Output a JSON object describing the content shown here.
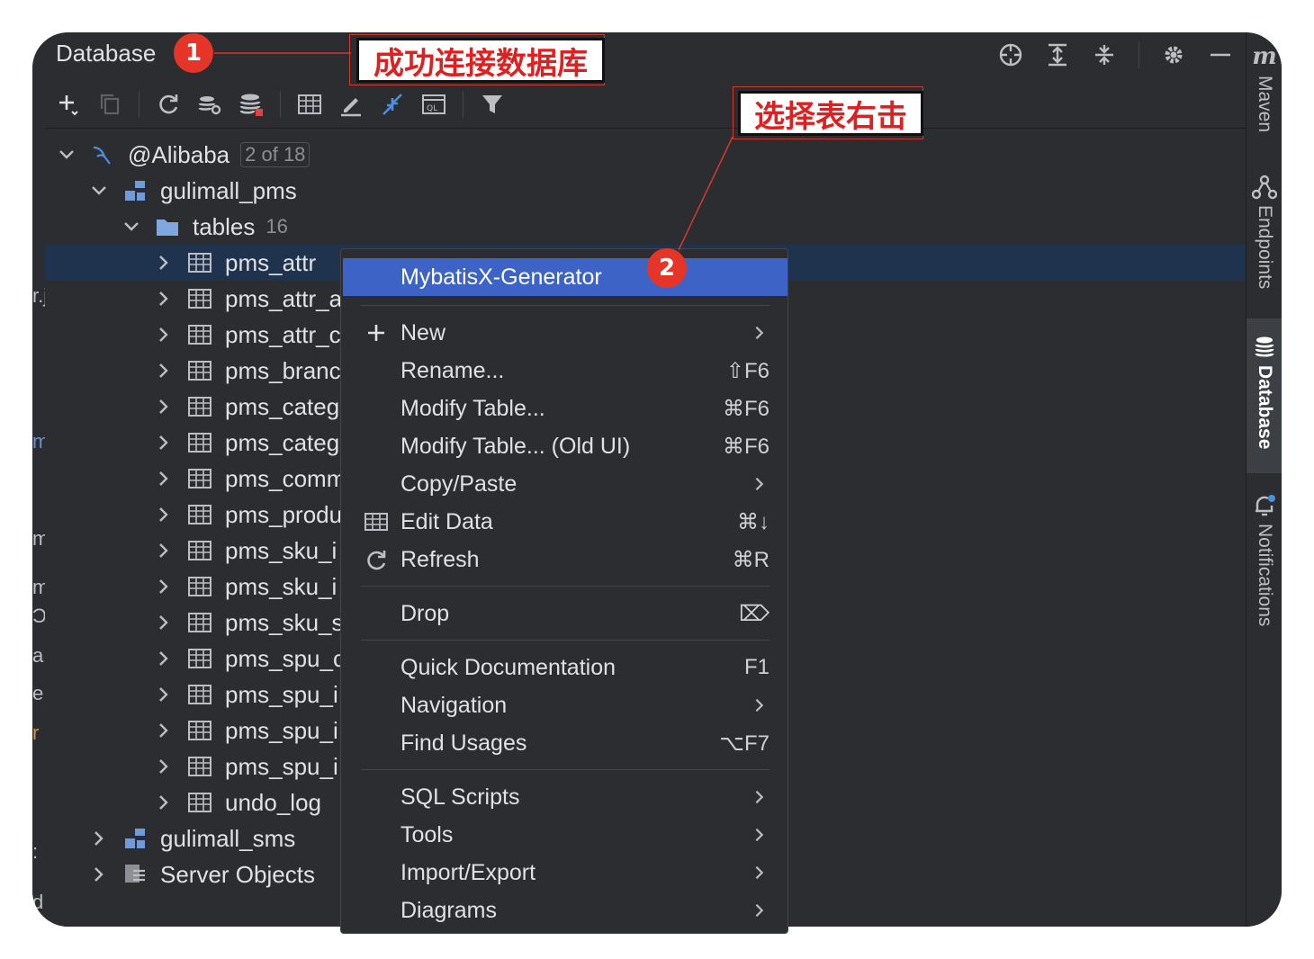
{
  "panel": {
    "title": "Database"
  },
  "tree": {
    "connection": {
      "label": "@Alibaba",
      "badge": "2 of 18"
    },
    "schema": "gulimall_pms",
    "tables_folder": {
      "label": "tables",
      "count": "16"
    },
    "tables": [
      "pms_attr",
      "pms_attr_a",
      "pms_attr_c",
      "pms_branc",
      "pms_categ",
      "pms_categ",
      "pms_comm",
      "pms_produ",
      "pms_sku_i",
      "pms_sku_i",
      "pms_sku_s",
      "pms_spu_c",
      "pms_spu_i",
      "pms_spu_i",
      "pms_spu_i",
      "undo_log"
    ],
    "other_schemas": [
      "gulimall_sms",
      "Server Objects"
    ]
  },
  "context_menu": {
    "highlighted": "MybatisX-Generator",
    "items": [
      {
        "label": "New",
        "shortcut": "",
        "submenu": true,
        "icon": "plus-icon"
      },
      {
        "label": "Rename...",
        "shortcut": "⇧F6"
      },
      {
        "label": "Modify Table...",
        "shortcut": "⌘F6"
      },
      {
        "label": "Modify Table... (Old UI)",
        "shortcut": "⌘F6"
      },
      {
        "label": "Copy/Paste",
        "shortcut": "",
        "submenu": true
      },
      {
        "label": "Edit Data",
        "shortcut": "⌘↓",
        "icon": "table-grid-icon"
      },
      {
        "label": "Refresh",
        "shortcut": "⌘R",
        "icon": "refresh-icon"
      },
      {
        "label": "Drop",
        "shortcut": "⌦"
      },
      {
        "label": "Quick Documentation",
        "shortcut": "F1"
      },
      {
        "label": "Navigation",
        "shortcut": "",
        "submenu": true
      },
      {
        "label": "Find Usages",
        "shortcut": "⌥F7"
      },
      {
        "label": "SQL Scripts",
        "shortcut": "",
        "submenu": true
      },
      {
        "label": "Tools",
        "shortcut": "",
        "submenu": true
      },
      {
        "label": "Import/Export",
        "shortcut": "",
        "submenu": true
      },
      {
        "label": "Diagrams",
        "shortcut": "",
        "submenu": true
      }
    ]
  },
  "side_tabs": {
    "maven": "Maven",
    "maven_logo": "m",
    "endpoints": "Endpoints",
    "database": "Database",
    "notifications": "Notifications"
  },
  "annotations": {
    "callout1": "成功连接数据库",
    "callout2": "选择表右击",
    "badge1": "1",
    "badge2": "2"
  },
  "left_edge_glyphs": [
    "r.j",
    "m",
    "m",
    "m",
    "Ɔ",
    "a",
    "e",
    "r",
    ":",
    "d"
  ],
  "colors": {
    "selection": "#1f334f",
    "menu_highlight": "#3d63c7",
    "annotation_red": "#e53529"
  }
}
